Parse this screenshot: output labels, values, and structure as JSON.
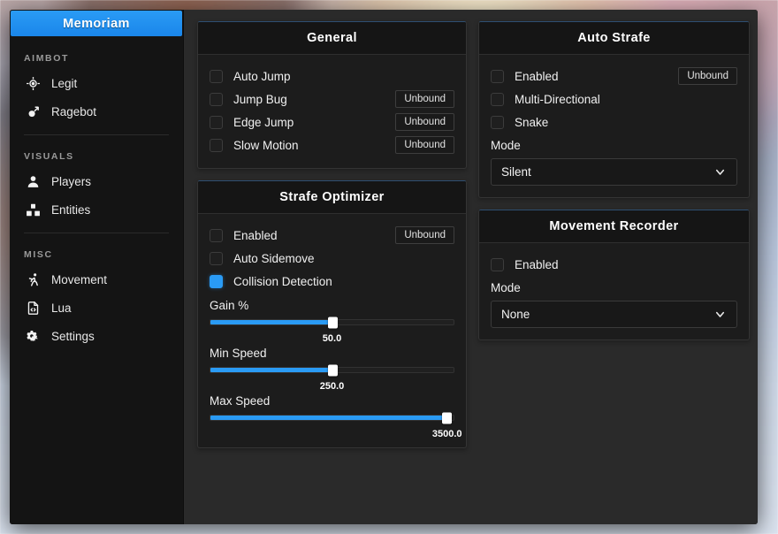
{
  "brand": {
    "title": "Memoriam"
  },
  "sidebar": {
    "groups": [
      {
        "label": "AIMBOT",
        "items": [
          {
            "label": "Legit",
            "icon": "crosshair-icon",
            "active": false
          },
          {
            "label": "Ragebot",
            "icon": "mars-symbol-icon",
            "active": false
          }
        ]
      },
      {
        "label": "VISUALS",
        "items": [
          {
            "label": "Players",
            "icon": "person-icon",
            "active": false
          },
          {
            "label": "Entities",
            "icon": "boxes-icon",
            "active": false
          }
        ]
      },
      {
        "label": "MISC",
        "items": [
          {
            "label": "Movement",
            "icon": "running-person-icon",
            "active": true
          },
          {
            "label": "Lua",
            "icon": "code-file-icon",
            "active": false
          },
          {
            "label": "Settings",
            "icon": "gears-icon",
            "active": false
          }
        ]
      }
    ]
  },
  "panels": {
    "general": {
      "title": "General",
      "rows": [
        {
          "label": "Auto Jump",
          "checked": false,
          "keybind": null
        },
        {
          "label": "Jump Bug",
          "checked": false,
          "keybind": "Unbound"
        },
        {
          "label": "Edge Jump",
          "checked": false,
          "keybind": "Unbound"
        },
        {
          "label": "Slow Motion",
          "checked": false,
          "keybind": "Unbound"
        }
      ]
    },
    "strafe_optimizer": {
      "title": "Strafe Optimizer",
      "rows": [
        {
          "label": "Enabled",
          "checked": false,
          "keybind": "Unbound"
        },
        {
          "label": "Auto Sidemove",
          "checked": false,
          "keybind": null
        },
        {
          "label": "Collision Detection",
          "checked": true,
          "keybind": null
        }
      ],
      "sliders": [
        {
          "label": "Gain %",
          "value": "50.0",
          "percent": 50
        },
        {
          "label": "Min Speed",
          "value": "250.0",
          "percent": 50
        },
        {
          "label": "Max Speed",
          "value": "3500.0",
          "percent": 97
        }
      ]
    },
    "auto_strafe": {
      "title": "Auto Strafe",
      "rows": [
        {
          "label": "Enabled",
          "checked": false,
          "keybind": "Unbound"
        },
        {
          "label": "Multi-Directional",
          "checked": false,
          "keybind": null
        },
        {
          "label": "Snake",
          "checked": false,
          "keybind": null
        }
      ],
      "mode_label": "Mode",
      "mode_value": "Silent"
    },
    "movement_recorder": {
      "title": "Movement Recorder",
      "rows": [
        {
          "label": "Enabled",
          "checked": false,
          "keybind": null
        }
      ],
      "mode_label": "Mode",
      "mode_value": "None"
    }
  },
  "colors": {
    "accent": "#2a9bf5",
    "panel_bg": "#1c1c1c",
    "sidebar_bg": "#141414",
    "content_bg": "#2a2a2a"
  }
}
